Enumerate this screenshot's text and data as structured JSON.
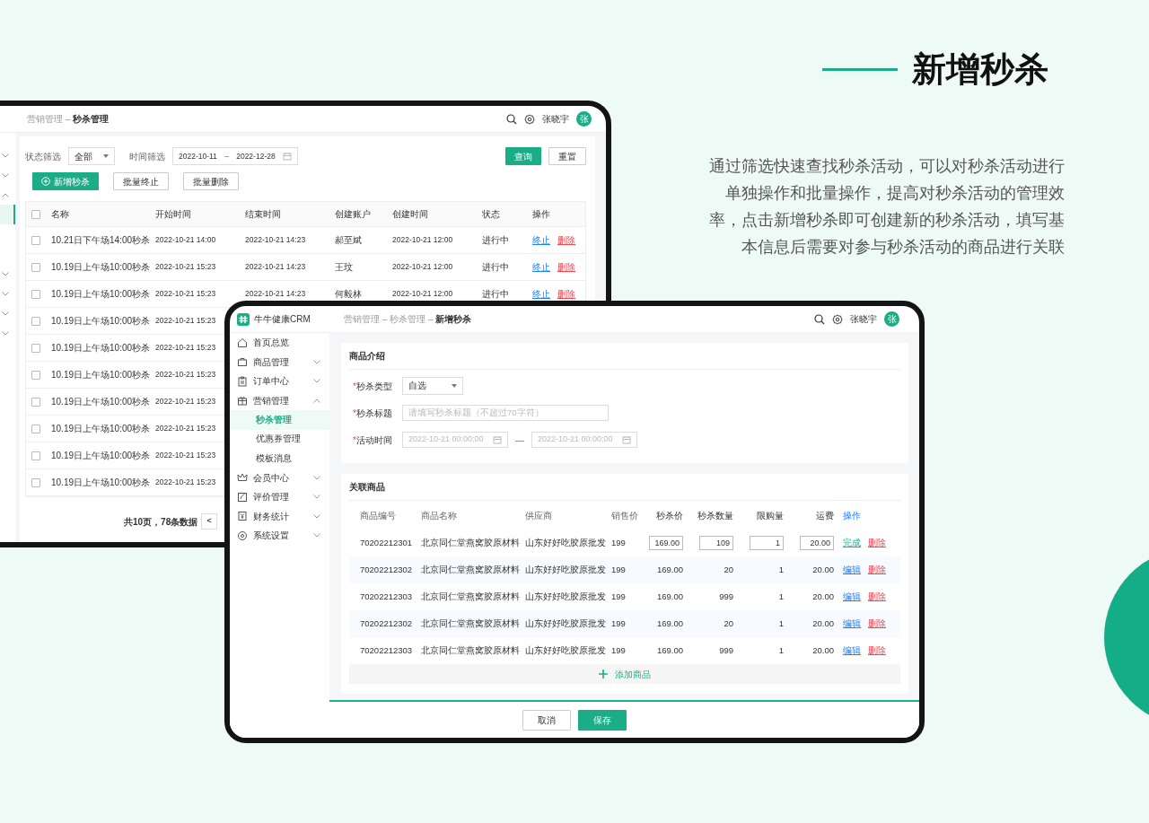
{
  "headline": {
    "title": "新增秒杀",
    "description": "通过筛选快速查找秒杀活动，可以对秒杀活动进行单独操作和批量操作，提高对秒杀活动的管理效率，点击新增秒杀即可创建新的秒杀活动，填写基本信息后需要对参与秒杀活动的商品进行关联"
  },
  "list_screen": {
    "breadcrumb": "营销管理 – **秒杀管理**",
    "user": {
      "name": "张晓宇",
      "avatar": "张"
    },
    "sidebar": [
      {
        "kind": "group",
        "expanded": false
      },
      {
        "kind": "group",
        "expanded": false
      },
      {
        "kind": "group",
        "expanded": true
      },
      {
        "kind": "sub",
        "selected": true
      },
      {
        "kind": "sub",
        "selected": false
      },
      {
        "kind": "sub",
        "selected": false
      },
      {
        "kind": "group",
        "expanded": false
      },
      {
        "kind": "group",
        "expanded": false
      },
      {
        "kind": "group",
        "expanded": false
      },
      {
        "kind": "group",
        "expanded": false
      }
    ],
    "filters": {
      "status_label": "状态筛选",
      "status_value": "全部",
      "time_label": "时间筛选",
      "start": "2022-10-11",
      "range_separator": "–",
      "end": "2022-12-28",
      "query": "查询",
      "reset": "重置"
    },
    "actions": [
      "新增秒杀",
      "批量终止",
      "批量删除"
    ],
    "table": {
      "select_all": {
        "checked": false
      },
      "columns": [
        "名称",
        "开始时间",
        "结束时间",
        "创建账户",
        "创建时间",
        "状态",
        "操作"
      ],
      "rows": [
        {
          "checked": false,
          "name": "10.21日下午场14:00秒杀",
          "start": "2022-10-21 14:00",
          "end": "2022-10-21 14:23",
          "account": "郝至斌",
          "created": "2022-10-21 12:00",
          "status": "进行中",
          "actions": [
            {
              "label": "终止",
              "kind": "primary"
            },
            {
              "label": "删除",
              "kind": "danger"
            }
          ]
        },
        {
          "checked": false,
          "name": "10.19日上午场10:00秒杀",
          "start": "2022-10-21 15:23",
          "end": "2022-10-21 14:23",
          "account": "王玟",
          "created": "2022-10-21 12:00",
          "status": "进行中",
          "actions": [
            {
              "label": "终止",
              "kind": "primary"
            },
            {
              "label": "删除",
              "kind": "danger"
            }
          ]
        },
        {
          "checked": false,
          "name": "10.19日上午场10:00秒杀",
          "start": "2022-10-21 15:23",
          "end": "2022-10-21 14:23",
          "account": "何毅林",
          "created": "2022-10-21 12:00",
          "status": "进行中",
          "actions": [
            {
              "label": "终止",
              "kind": "primary"
            },
            {
              "label": "删除",
              "kind": "danger"
            }
          ]
        },
        {
          "checked": false,
          "name": "10.19日上午场10:00秒杀",
          "start": "2022-10-21 15:23"
        },
        {
          "checked": false,
          "name": "10.19日上午场10:00秒杀",
          "start": "2022-10-21 15:23"
        },
        {
          "checked": false,
          "name": "10.19日上午场10:00秒杀",
          "start": "2022-10-21 15:23"
        },
        {
          "checked": false,
          "name": "10.19日上午场10:00秒杀",
          "start": "2022-10-21 15:23"
        },
        {
          "checked": false,
          "name": "10.19日上午场10:00秒杀",
          "start": "2022-10-21 15:23"
        },
        {
          "checked": false,
          "name": "10.19日上午场10:00秒杀",
          "start": "2022-10-21 15:23"
        },
        {
          "checked": false,
          "name": "10.19日上午场10:00秒杀",
          "start": "2022-10-21 15:23"
        }
      ]
    },
    "pagination": {
      "summary": "共10页，78条数据",
      "prev": "<"
    }
  },
  "form_screen": {
    "brand": "牛牛健康CRM",
    "breadcrumb": "营销管理 – 秒杀管理 – **新增秒杀**",
    "user": {
      "name": "张晓宇",
      "avatar": "张"
    },
    "sidebar": [
      {
        "kind": "item",
        "label": "首页总览"
      },
      {
        "kind": "group",
        "label": "商品管理",
        "expanded": false
      },
      {
        "kind": "group",
        "label": "订单中心",
        "expanded": false
      },
      {
        "kind": "group",
        "label": "营销管理",
        "expanded": true
      },
      {
        "kind": "sub",
        "label": "秒杀管理",
        "selected": true
      },
      {
        "kind": "sub",
        "label": "优惠券管理",
        "selected": false
      },
      {
        "kind": "sub",
        "label": "模板消息",
        "selected": false
      },
      {
        "kind": "group",
        "label": "会员中心",
        "expanded": false
      },
      {
        "kind": "group",
        "label": "评价管理",
        "expanded": false
      },
      {
        "kind": "group",
        "label": "财务统计",
        "expanded": false
      },
      {
        "kind": "group",
        "label": "系统设置",
        "expanded": false
      }
    ],
    "intro": {
      "title": "商品介绍",
      "fields": [
        {
          "kind": "select",
          "marker": "*",
          "label": "秒杀类型",
          "value": "自选"
        },
        {
          "kind": "text",
          "marker": "*",
          "label": "秒杀标题",
          "placeholder": "请填写秒杀标题（不超过70字符）"
        },
        {
          "kind": "daterange",
          "marker": "*",
          "label": "活动时间",
          "start_placeholder": "2022-10-21 00:00:00",
          "separator": "—",
          "end_placeholder": "2022-10-21 00:00:00"
        }
      ]
    },
    "products": {
      "title": "关联商品",
      "columns": [
        "商品编号",
        "商品名称",
        "供应商",
        "销售价",
        "秒杀价",
        "秒杀数量",
        "限购量",
        "运费",
        "操作"
      ],
      "rows": [
        {
          "kind": "editing",
          "code": "70202212301",
          "name": "北京同仁堂燕窝胶原材料",
          "supplier": "山东好好吃胶原批发",
          "price": "199",
          "flash_price": "169.00",
          "flash_qty": "109",
          "limit": "1",
          "shipping": "20.00",
          "actions": [
            {
              "label": "完成",
              "kind": "success"
            },
            {
              "label": "删除",
              "kind": "danger"
            }
          ]
        },
        {
          "kind": "view",
          "code": "70202212302",
          "name": "北京同仁堂燕窝胶原材料",
          "supplier": "山东好好吃胶原批发",
          "price": "199",
          "flash_price": "169.00",
          "flash_qty": "20",
          "limit": "1",
          "shipping": "20.00",
          "actions": [
            {
              "label": "编辑",
              "kind": "primary"
            },
            {
              "label": "删除",
              "kind": "danger"
            }
          ]
        },
        {
          "kind": "view",
          "code": "70202212303",
          "name": "北京同仁堂燕窝胶原材料",
          "supplier": "山东好好吃胶原批发",
          "price": "199",
          "flash_price": "169.00",
          "flash_qty": "999",
          "limit": "1",
          "shipping": "20.00",
          "actions": [
            {
              "label": "编辑",
              "kind": "primary"
            },
            {
              "label": "删除",
              "kind": "danger"
            }
          ]
        },
        {
          "kind": "view",
          "code": "70202212302",
          "name": "北京同仁堂燕窝胶原材料",
          "supplier": "山东好好吃胶原批发",
          "price": "199",
          "flash_price": "169.00",
          "flash_qty": "20",
          "limit": "1",
          "shipping": "20.00",
          "actions": [
            {
              "label": "编辑",
              "kind": "primary"
            },
            {
              "label": "删除",
              "kind": "danger"
            }
          ]
        },
        {
          "kind": "view",
          "code": "70202212303",
          "name": "北京同仁堂燕窝胶原材料",
          "supplier": "山东好好吃胶原批发",
          "price": "199",
          "flash_price": "169.00",
          "flash_qty": "999",
          "limit": "1",
          "shipping": "20.00",
          "actions": [
            {
              "label": "编辑",
              "kind": "primary"
            },
            {
              "label": "删除",
              "kind": "danger"
            }
          ]
        }
      ],
      "add": "添加商品"
    },
    "footer": {
      "cancel": "取消",
      "save": "保存"
    }
  }
}
